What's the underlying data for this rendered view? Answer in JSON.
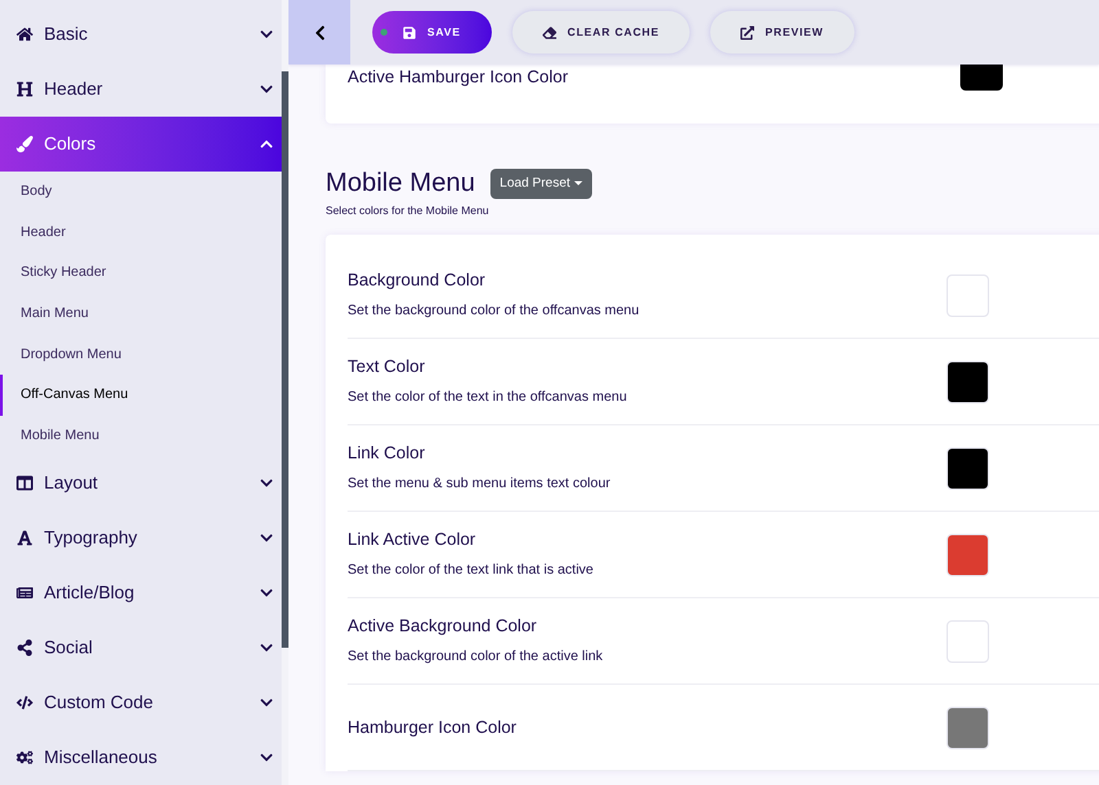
{
  "sidebar": {
    "items": [
      {
        "label": "Basic",
        "expanded": false
      },
      {
        "label": "Header",
        "expanded": false
      },
      {
        "label": "Colors",
        "expanded": true,
        "children": [
          {
            "label": "Body",
            "selected": false
          },
          {
            "label": "Header",
            "selected": false
          },
          {
            "label": "Sticky Header",
            "selected": false
          },
          {
            "label": "Main Menu",
            "selected": false
          },
          {
            "label": "Dropdown Menu",
            "selected": false
          },
          {
            "label": "Off-Canvas Menu",
            "selected": true
          },
          {
            "label": "Mobile Menu",
            "selected": false
          }
        ]
      },
      {
        "label": "Layout",
        "expanded": false
      },
      {
        "label": "Typography",
        "expanded": false
      },
      {
        "label": "Article/Blog",
        "expanded": false
      },
      {
        "label": "Social",
        "expanded": false
      },
      {
        "label": "Custom Code",
        "expanded": false
      },
      {
        "label": "Miscellaneous",
        "expanded": false
      }
    ]
  },
  "toolbar": {
    "buttons": [
      "SAVE",
      "CLEAR CACHE",
      "PREVIEW"
    ]
  },
  "previous_card": {
    "label": "Active Hamburger Icon Color",
    "color": "#000000"
  },
  "section": {
    "title": "Mobile Menu",
    "preset_button": "Load Preset",
    "subtitle": "Select colors for the Mobile Menu",
    "rows": [
      {
        "label": "Background Color",
        "description": "Set the background color of the offcanvas menu",
        "color": "#ffffff"
      },
      {
        "label": "Text Color",
        "description": "Set the color of the text in the offcanvas menu",
        "color": "#000000"
      },
      {
        "label": "Link Color",
        "description": "Set the menu & sub menu items text colour",
        "color": "#000000"
      },
      {
        "label": "Link Active Color",
        "description": "Set the color of the text link that is active",
        "color": "#db3c30"
      },
      {
        "label": "Active Background Color",
        "description": "Set the background color of the active link",
        "color": "#ffffff"
      },
      {
        "label": "Hamburger Icon Color",
        "color": "#777777"
      }
    ]
  }
}
